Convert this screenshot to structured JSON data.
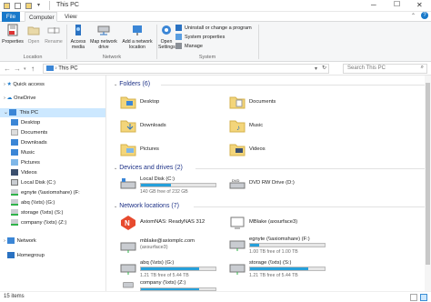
{
  "window": {
    "title": "This PC",
    "minimize": "─",
    "maximize": "☐",
    "close": "✕"
  },
  "tabs": [
    {
      "label": "File"
    },
    {
      "label": "Computer"
    },
    {
      "label": "View"
    }
  ],
  "ribbon": {
    "location": {
      "label": "Location",
      "properties": "Properties",
      "open": "Open",
      "rename": "Rename"
    },
    "network": {
      "label": "Network",
      "access_media": "Access media",
      "map_drive": "Map network drive",
      "add_location": "Add a network location"
    },
    "system": {
      "label": "System",
      "open_settings": "Open Settings",
      "uninstall": "Uninstall or change a program",
      "system_properties": "System properties",
      "manage": "Manage"
    }
  },
  "address": {
    "path": "This PC",
    "search_placeholder": "Search This PC"
  },
  "nav": {
    "items": [
      {
        "label": "Quick access"
      },
      {
        "label": "OneDrive"
      },
      {
        "label": "This PC"
      },
      {
        "label": "Desktop"
      },
      {
        "label": "Documents"
      },
      {
        "label": "Downloads"
      },
      {
        "label": "Music"
      },
      {
        "label": "Pictures"
      },
      {
        "label": "Videos"
      },
      {
        "label": "Local Disk (C:)"
      },
      {
        "label": "egnyte (\\\\axiomshare) (F:"
      },
      {
        "label": "abq (\\\\xts) (G:)"
      },
      {
        "label": "storage (\\\\xts) (S:)"
      },
      {
        "label": "company (\\\\xts) (Z:)"
      },
      {
        "label": "Network"
      },
      {
        "label": "Homegroup"
      }
    ]
  },
  "folders": {
    "header": "Folders (6)",
    "items": [
      {
        "label": "Desktop"
      },
      {
        "label": "Documents"
      },
      {
        "label": "Downloads"
      },
      {
        "label": "Music"
      },
      {
        "label": "Pictures"
      },
      {
        "label": "Videos"
      }
    ]
  },
  "drives": {
    "header": "Devices and drives (2)",
    "local": {
      "label": "Local Disk (C:)",
      "free": "140 GB free of 232 GB",
      "used_fraction": 0.4
    },
    "dvd": {
      "label": "DVD RW Drive (D:)"
    }
  },
  "network": {
    "header": "Network locations (7)",
    "items": [
      {
        "label": "AxiomNAS: ReadyNAS 312"
      },
      {
        "label": "MBlake (axsurface3)"
      },
      {
        "label": "mblake@axiomplc.com",
        "sub": "(axsurface3)"
      },
      {
        "label": "egnyte (\\\\axiomshare) (F:)",
        "free": "1.00 TB free of 1.00 TB",
        "used_fraction": 0.12
      },
      {
        "label": "abq (\\\\xts) (G:)",
        "free": "1.21 TB free of 5.44 TB",
        "used_fraction": 0.78
      },
      {
        "label": "storage (\\\\xts) (S:)",
        "free": "1.21 TB free of 5.44 TB",
        "used_fraction": 0.78
      },
      {
        "label": "company (\\\\xts) (Z:)",
        "used_fraction": 0.78
      }
    ]
  },
  "status": {
    "count": "15 items"
  }
}
